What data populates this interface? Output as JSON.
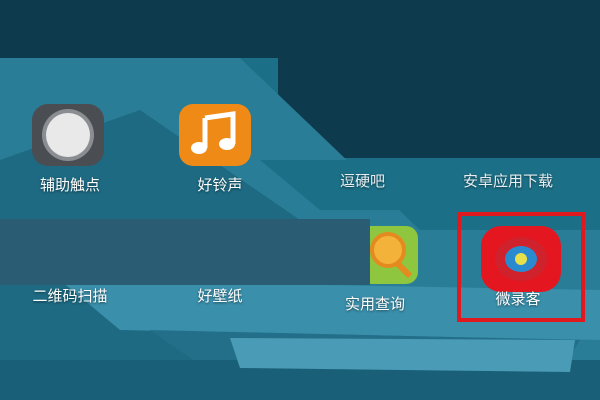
{
  "colors": {
    "wallpaper": "#1b6f86",
    "dark_block": "#0d3a4c",
    "highlight_border": "#e0191f",
    "music_icon_bg": "#f08a17",
    "record_icon_red": "#e4161f",
    "record_icon_blue": "#2a8ad0",
    "record_icon_dot": "#e7e04a"
  },
  "apps": {
    "assistive_touch": {
      "label": "辅助触点",
      "icon": "assistive-touch-icon"
    },
    "ringtone": {
      "label": "好铃声",
      "icon": "music-note-icon"
    },
    "app3_partial": {
      "label": "逗硬吧",
      "icon": ""
    },
    "app_store": {
      "label": "安卓应用下载",
      "icon": ""
    },
    "qr_scan": {
      "label": "二维码扫描",
      "icon": "qr-scan-icon"
    },
    "wallpaper": {
      "label": "好壁纸",
      "icon": "wallpaper-icon"
    },
    "lookup": {
      "label": "实用查询",
      "icon": "magnifier-icon"
    },
    "screen_recorder": {
      "label": "微录客",
      "icon": "record-target-icon"
    }
  }
}
